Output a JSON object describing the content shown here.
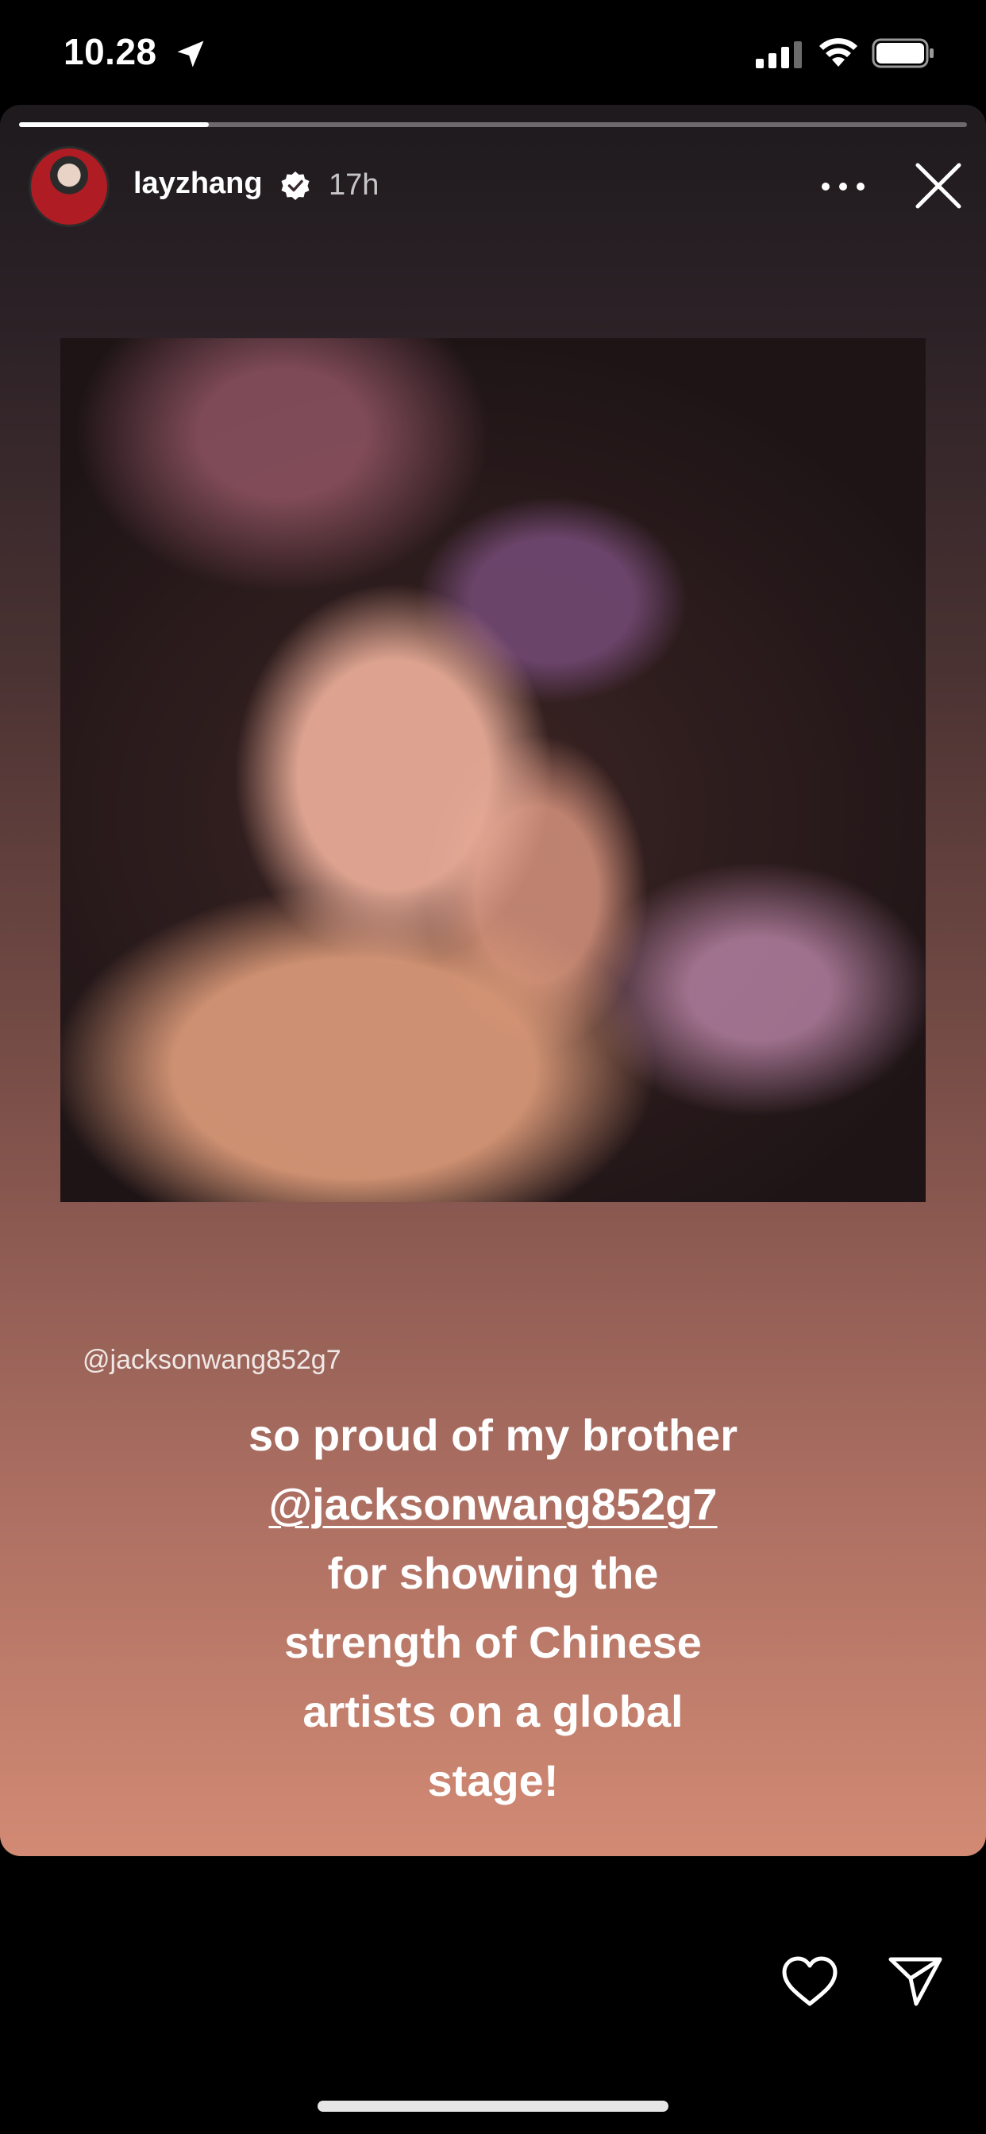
{
  "status_bar": {
    "time": "10.28",
    "icons": [
      "location-arrow-icon",
      "cellular-signal-icon",
      "wifi-icon",
      "battery-icon"
    ]
  },
  "story": {
    "progress": 0.2,
    "user": {
      "username": "layzhang",
      "verified": true,
      "timestamp": "17h"
    },
    "mention_sticker": "@jacksonwang852g7",
    "caption": {
      "line1": "so proud of my brother",
      "mention": "@jacksonwang852g7",
      "line3": "for showing the",
      "line4": "strength of Chinese",
      "line5": "artists on a global",
      "line6": "stage!"
    }
  },
  "actions": {
    "icons": [
      "more-options-icon",
      "close-icon",
      "heart-icon",
      "send-icon"
    ]
  }
}
